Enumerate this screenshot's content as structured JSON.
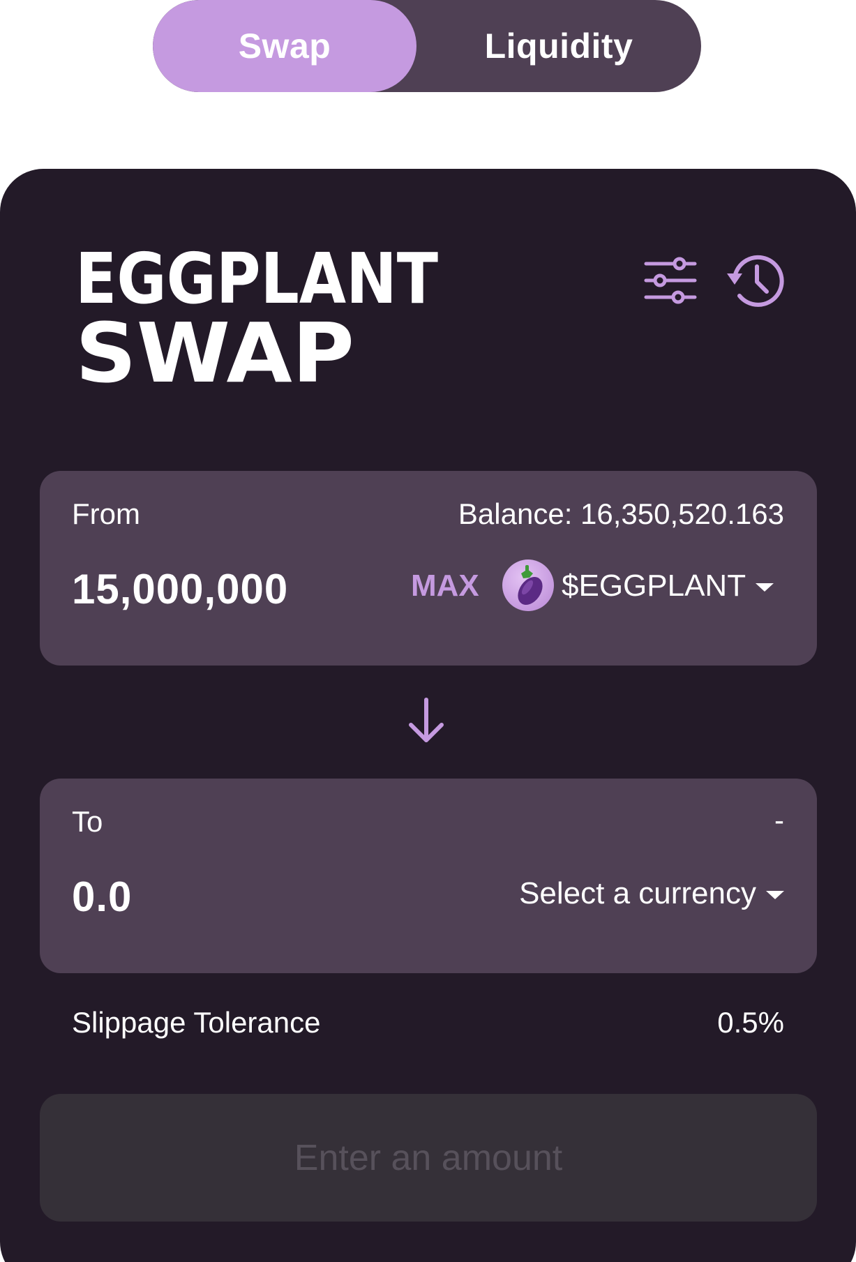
{
  "tabs": {
    "swap": "Swap",
    "liquidity": "Liquidity",
    "active": "swap"
  },
  "logo": {
    "line1": "EGGPLANT",
    "line2": "SWAP"
  },
  "icons": {
    "settings": "sliders-icon",
    "history": "history-icon",
    "swap_direction": "arrow-down-icon",
    "token": "eggplant-emoji"
  },
  "from": {
    "label": "From",
    "balance": "Balance: 16,350,520.163",
    "amount": "15,000,000",
    "max_label": "MAX",
    "token_avatar": "🍆",
    "token": "$EGGPLANT"
  },
  "to": {
    "label": "To",
    "balance": "-",
    "amount": "0.0",
    "currency_placeholder": "Select a currency"
  },
  "slippage": {
    "label": "Slippage Tolerance",
    "value": "0.5%"
  },
  "submit": {
    "label": "Enter an amount",
    "enabled": false
  },
  "colors": {
    "accent": "#c59ae0",
    "card": "#231a28",
    "panel": "#4f4054",
    "disabled": "#353038"
  }
}
